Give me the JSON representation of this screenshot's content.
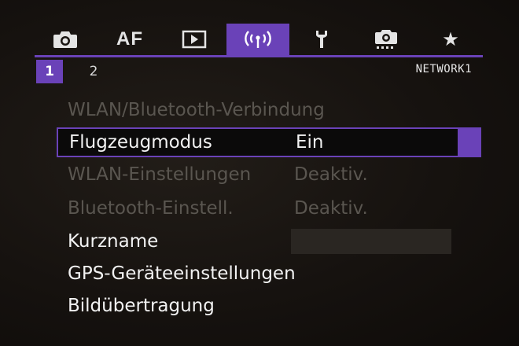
{
  "tabs": [
    {
      "icon": "camera-icon"
    },
    {
      "label": "AF"
    },
    {
      "icon": "playback-icon"
    },
    {
      "icon": "wireless-icon"
    },
    {
      "icon": "wrench-icon"
    },
    {
      "icon": "custom-camera-icon"
    },
    {
      "label": "★"
    }
  ],
  "active_tab": 3,
  "subtabs": [
    "1",
    "2"
  ],
  "page_label": "NETWORK1",
  "menu": [
    {
      "label": "WLAN/Bluetooth-Verbindung",
      "value": "",
      "state": "dim"
    },
    {
      "label": "Flugzeugmodus",
      "value": "Ein",
      "state": "selected"
    },
    {
      "label": "WLAN-Einstellungen",
      "value": "Deaktiv.",
      "state": "dim"
    },
    {
      "label": "Bluetooth-Einstell.",
      "value": "Deaktiv.",
      "state": "dim"
    },
    {
      "label": "Kurzname",
      "value": "",
      "state": "normal"
    },
    {
      "label": "GPS-Geräteeinstellungen",
      "value": "",
      "state": "normal"
    },
    {
      "label": "Bildübertragung",
      "value": "",
      "state": "normal"
    }
  ],
  "colors": {
    "accent": "#6a42b8",
    "text": "#f2f2f2",
    "dim_text": "#5a5650"
  }
}
